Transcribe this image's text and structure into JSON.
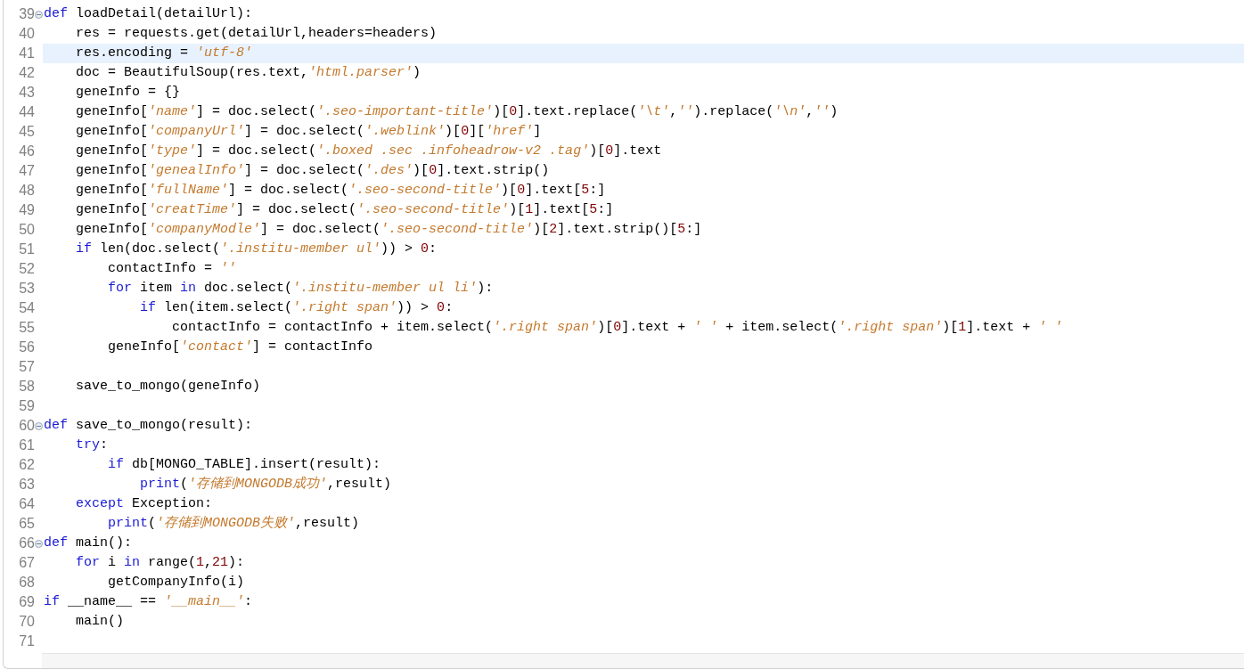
{
  "editor": {
    "lines": [
      {
        "number": "39",
        "collapsible": true,
        "current": false,
        "tokens": [
          {
            "text": "def",
            "kind": "keyword"
          },
          {
            "text": " loadDetail(detailUrl):",
            "kind": "plain"
          }
        ]
      },
      {
        "number": "40",
        "collapsible": false,
        "current": false,
        "tokens": [
          {
            "text": "    res = requests.get(detailUrl,headers=headers)",
            "kind": "plain"
          }
        ]
      },
      {
        "number": "41",
        "collapsible": false,
        "current": true,
        "tokens": [
          {
            "text": "    res.encoding = ",
            "kind": "plain"
          },
          {
            "text": "'utf-8'",
            "kind": "string"
          }
        ]
      },
      {
        "number": "42",
        "collapsible": false,
        "current": false,
        "tokens": [
          {
            "text": "    doc = BeautifulSoup(res.text,",
            "kind": "plain"
          },
          {
            "text": "'html.parser'",
            "kind": "string"
          },
          {
            "text": ")",
            "kind": "plain"
          }
        ]
      },
      {
        "number": "43",
        "collapsible": false,
        "current": false,
        "tokens": [
          {
            "text": "    geneInfo = {}",
            "kind": "plain"
          }
        ]
      },
      {
        "number": "44",
        "collapsible": false,
        "current": false,
        "tokens": [
          {
            "text": "    geneInfo[",
            "kind": "plain"
          },
          {
            "text": "'name'",
            "kind": "string"
          },
          {
            "text": "] = doc.select(",
            "kind": "plain"
          },
          {
            "text": "'.seo-important-title'",
            "kind": "string"
          },
          {
            "text": ")[",
            "kind": "plain"
          },
          {
            "text": "0",
            "kind": "number"
          },
          {
            "text": "].text.replace(",
            "kind": "plain"
          },
          {
            "text": "'\\t'",
            "kind": "string"
          },
          {
            "text": ",",
            "kind": "plain"
          },
          {
            "text": "''",
            "kind": "string"
          },
          {
            "text": ").replace(",
            "kind": "plain"
          },
          {
            "text": "'\\n'",
            "kind": "string"
          },
          {
            "text": ",",
            "kind": "plain"
          },
          {
            "text": "''",
            "kind": "string"
          },
          {
            "text": ")",
            "kind": "plain"
          }
        ]
      },
      {
        "number": "45",
        "collapsible": false,
        "current": false,
        "tokens": [
          {
            "text": "    geneInfo[",
            "kind": "plain"
          },
          {
            "text": "'companyUrl'",
            "kind": "string"
          },
          {
            "text": "] = doc.select(",
            "kind": "plain"
          },
          {
            "text": "'.weblink'",
            "kind": "string"
          },
          {
            "text": ")[",
            "kind": "plain"
          },
          {
            "text": "0",
            "kind": "number"
          },
          {
            "text": "][",
            "kind": "plain"
          },
          {
            "text": "'href'",
            "kind": "string"
          },
          {
            "text": "]",
            "kind": "plain"
          }
        ]
      },
      {
        "number": "46",
        "collapsible": false,
        "current": false,
        "tokens": [
          {
            "text": "    geneInfo[",
            "kind": "plain"
          },
          {
            "text": "'type'",
            "kind": "string"
          },
          {
            "text": "] = doc.select(",
            "kind": "plain"
          },
          {
            "text": "'.boxed .sec .infoheadrow-v2 .tag'",
            "kind": "string"
          },
          {
            "text": ")[",
            "kind": "plain"
          },
          {
            "text": "0",
            "kind": "number"
          },
          {
            "text": "].text",
            "kind": "plain"
          }
        ]
      },
      {
        "number": "47",
        "collapsible": false,
        "current": false,
        "tokens": [
          {
            "text": "    geneInfo[",
            "kind": "plain"
          },
          {
            "text": "'genealInfo'",
            "kind": "string"
          },
          {
            "text": "] = doc.select(",
            "kind": "plain"
          },
          {
            "text": "'.des'",
            "kind": "string"
          },
          {
            "text": ")[",
            "kind": "plain"
          },
          {
            "text": "0",
            "kind": "number"
          },
          {
            "text": "].text.strip()",
            "kind": "plain"
          }
        ]
      },
      {
        "number": "48",
        "collapsible": false,
        "current": false,
        "tokens": [
          {
            "text": "    geneInfo[",
            "kind": "plain"
          },
          {
            "text": "'fullName'",
            "kind": "string"
          },
          {
            "text": "] = doc.select(",
            "kind": "plain"
          },
          {
            "text": "'.seo-second-title'",
            "kind": "string"
          },
          {
            "text": ")[",
            "kind": "plain"
          },
          {
            "text": "0",
            "kind": "number"
          },
          {
            "text": "].text[",
            "kind": "plain"
          },
          {
            "text": "5",
            "kind": "number"
          },
          {
            "text": ":]",
            "kind": "plain"
          }
        ]
      },
      {
        "number": "49",
        "collapsible": false,
        "current": false,
        "tokens": [
          {
            "text": "    geneInfo[",
            "kind": "plain"
          },
          {
            "text": "'creatTime'",
            "kind": "string"
          },
          {
            "text": "] = doc.select(",
            "kind": "plain"
          },
          {
            "text": "'.seo-second-title'",
            "kind": "string"
          },
          {
            "text": ")[",
            "kind": "plain"
          },
          {
            "text": "1",
            "kind": "number"
          },
          {
            "text": "].text[",
            "kind": "plain"
          },
          {
            "text": "5",
            "kind": "number"
          },
          {
            "text": ":]",
            "kind": "plain"
          }
        ]
      },
      {
        "number": "50",
        "collapsible": false,
        "current": false,
        "tokens": [
          {
            "text": "    geneInfo[",
            "kind": "plain"
          },
          {
            "text": "'companyModle'",
            "kind": "string"
          },
          {
            "text": "] = doc.select(",
            "kind": "plain"
          },
          {
            "text": "'.seo-second-title'",
            "kind": "string"
          },
          {
            "text": ")[",
            "kind": "plain"
          },
          {
            "text": "2",
            "kind": "number"
          },
          {
            "text": "].text.strip()[",
            "kind": "plain"
          },
          {
            "text": "5",
            "kind": "number"
          },
          {
            "text": ":]",
            "kind": "plain"
          }
        ]
      },
      {
        "number": "51",
        "collapsible": false,
        "current": false,
        "tokens": [
          {
            "text": "    if",
            "kind": "keyword"
          },
          {
            "text": " len(doc.select(",
            "kind": "plain"
          },
          {
            "text": "'.institu-member ul'",
            "kind": "string"
          },
          {
            "text": ")) > ",
            "kind": "plain"
          },
          {
            "text": "0",
            "kind": "number"
          },
          {
            "text": ":",
            "kind": "plain"
          }
        ]
      },
      {
        "number": "52",
        "collapsible": false,
        "current": false,
        "tokens": [
          {
            "text": "        contactInfo = ",
            "kind": "plain"
          },
          {
            "text": "''",
            "kind": "string"
          }
        ]
      },
      {
        "number": "53",
        "collapsible": false,
        "current": false,
        "tokens": [
          {
            "text": "        for",
            "kind": "keyword"
          },
          {
            "text": " item ",
            "kind": "plain"
          },
          {
            "text": "in",
            "kind": "keyword"
          },
          {
            "text": " doc.select(",
            "kind": "plain"
          },
          {
            "text": "'.institu-member ul li'",
            "kind": "string"
          },
          {
            "text": "):",
            "kind": "plain"
          }
        ]
      },
      {
        "number": "54",
        "collapsible": false,
        "current": false,
        "tokens": [
          {
            "text": "            if",
            "kind": "keyword"
          },
          {
            "text": " len(item.select(",
            "kind": "plain"
          },
          {
            "text": "'.right span'",
            "kind": "string"
          },
          {
            "text": ")) > ",
            "kind": "plain"
          },
          {
            "text": "0",
            "kind": "number"
          },
          {
            "text": ":",
            "kind": "plain"
          }
        ]
      },
      {
        "number": "55",
        "collapsible": false,
        "current": false,
        "tokens": [
          {
            "text": "                contactInfo = contactInfo + item.select(",
            "kind": "plain"
          },
          {
            "text": "'.right span'",
            "kind": "string"
          },
          {
            "text": ")[",
            "kind": "plain"
          },
          {
            "text": "0",
            "kind": "number"
          },
          {
            "text": "].text + ",
            "kind": "plain"
          },
          {
            "text": "' '",
            "kind": "string"
          },
          {
            "text": " + item.select(",
            "kind": "plain"
          },
          {
            "text": "'.right span'",
            "kind": "string"
          },
          {
            "text": ")[",
            "kind": "plain"
          },
          {
            "text": "1",
            "kind": "number"
          },
          {
            "text": "].text + ",
            "kind": "plain"
          },
          {
            "text": "' '",
            "kind": "string"
          }
        ]
      },
      {
        "number": "56",
        "collapsible": false,
        "current": false,
        "tokens": [
          {
            "text": "        geneInfo[",
            "kind": "plain"
          },
          {
            "text": "'contact'",
            "kind": "string"
          },
          {
            "text": "] = contactInfo",
            "kind": "plain"
          }
        ]
      },
      {
        "number": "57",
        "collapsible": false,
        "current": false
      },
      {
        "number": "58",
        "collapsible": false,
        "current": false,
        "tokens": [
          {
            "text": "    save_to_mongo(geneInfo)",
            "kind": "plain"
          }
        ]
      },
      {
        "number": "59",
        "collapsible": false,
        "current": false
      },
      {
        "number": "60",
        "collapsible": true,
        "current": false,
        "tokens": [
          {
            "text": "def",
            "kind": "keyword"
          },
          {
            "text": " save_to_mongo(result):",
            "kind": "plain"
          }
        ]
      },
      {
        "number": "61",
        "collapsible": false,
        "current": false,
        "tokens": [
          {
            "text": "    try",
            "kind": "keyword"
          },
          {
            "text": ":",
            "kind": "plain"
          }
        ]
      },
      {
        "number": "62",
        "collapsible": false,
        "current": false,
        "tokens": [
          {
            "text": "        if",
            "kind": "keyword"
          },
          {
            "text": " db[MONGO_TABLE].insert(result):",
            "kind": "plain"
          }
        ]
      },
      {
        "number": "63",
        "collapsible": false,
        "current": false,
        "tokens": [
          {
            "text": "            print",
            "kind": "keyword"
          },
          {
            "text": "(",
            "kind": "plain"
          },
          {
            "text": "'存储到MONGODB成功'",
            "kind": "string"
          },
          {
            "text": ",result)",
            "kind": "plain"
          }
        ]
      },
      {
        "number": "64",
        "collapsible": false,
        "current": false,
        "tokens": [
          {
            "text": "    except",
            "kind": "keyword"
          },
          {
            "text": " Exception:",
            "kind": "plain"
          }
        ]
      },
      {
        "number": "65",
        "collapsible": false,
        "current": false,
        "tokens": [
          {
            "text": "        print",
            "kind": "keyword"
          },
          {
            "text": "(",
            "kind": "plain"
          },
          {
            "text": "'存储到MONGODB失败'",
            "kind": "string"
          },
          {
            "text": ",result)",
            "kind": "plain"
          }
        ]
      },
      {
        "number": "66",
        "collapsible": true,
        "current": false,
        "tokens": [
          {
            "text": "def",
            "kind": "keyword"
          },
          {
            "text": " main():",
            "kind": "plain"
          }
        ]
      },
      {
        "number": "67",
        "collapsible": false,
        "current": false,
        "tokens": [
          {
            "text": "    for",
            "kind": "keyword"
          },
          {
            "text": " i ",
            "kind": "plain"
          },
          {
            "text": "in",
            "kind": "keyword"
          },
          {
            "text": " range(",
            "kind": "plain"
          },
          {
            "text": "1",
            "kind": "number"
          },
          {
            "text": ",",
            "kind": "plain"
          },
          {
            "text": "21",
            "kind": "number"
          },
          {
            "text": "):",
            "kind": "plain"
          }
        ]
      },
      {
        "number": "68",
        "collapsible": false,
        "current": false,
        "tokens": [
          {
            "text": "        getCompanyInfo(i)",
            "kind": "plain"
          }
        ]
      },
      {
        "number": "69",
        "collapsible": false,
        "current": false,
        "tokens": [
          {
            "text": "if",
            "kind": "keyword"
          },
          {
            "text": " __name__ == ",
            "kind": "plain"
          },
          {
            "text": "'__main__'",
            "kind": "string"
          },
          {
            "text": ":",
            "kind": "plain"
          }
        ]
      },
      {
        "number": "70",
        "collapsible": false,
        "current": false,
        "tokens": [
          {
            "text": "    main()",
            "kind": "plain"
          }
        ]
      },
      {
        "number": "71",
        "collapsible": false,
        "current": false
      }
    ]
  }
}
